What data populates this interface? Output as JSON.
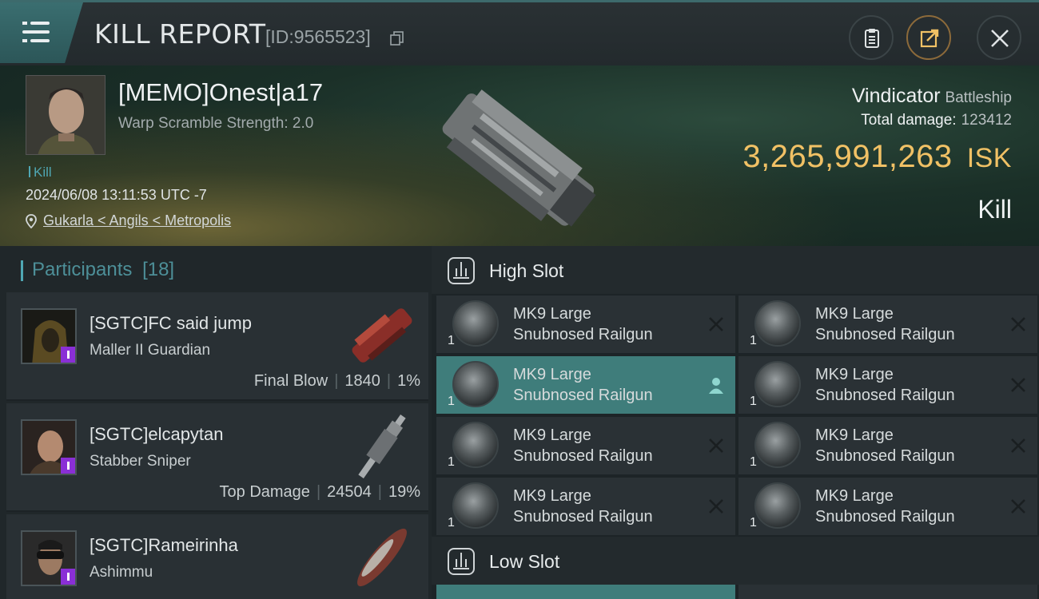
{
  "header": {
    "title": "KILL REPORT",
    "report_id": "[ID:9565523]",
    "icons": [
      "menu-icon",
      "copy-icon",
      "clipboard-icon",
      "share-icon",
      "close-icon"
    ]
  },
  "victim": {
    "name": "[MEMO]Onest|a17",
    "warp_scramble": "Warp Scramble Strength: 2.0",
    "tag": "Kill",
    "timestamp": "2024/06/08 13:11:53 UTC -7",
    "location": "Gukarla < Angils < Metropolis",
    "ship_name": "Vindicator",
    "ship_class": "Battleship",
    "total_damage_label": "Total damage:",
    "total_damage": "123412",
    "isk_value": "3,265,991,263",
    "isk_unit": "ISK",
    "result": "Kill"
  },
  "participants": {
    "label": "Participants",
    "count": "[18]",
    "rows": [
      {
        "name": "[SGTC]FC said jump",
        "ship": "Maller II Guardian",
        "role": "Final Blow",
        "damage": "1840",
        "percent": "1%"
      },
      {
        "name": "[SGTC]elcapytan",
        "ship": "Stabber Sniper",
        "role": "Top Damage",
        "damage": "24504",
        "percent": "19%"
      },
      {
        "name": "[SGTC]Rameirinha",
        "ship": "Ashimmu",
        "role": "",
        "damage": "",
        "percent": ""
      }
    ]
  },
  "fitting": {
    "high_slot_label": "High Slot",
    "low_slot_label": "Low Slot",
    "module_line1": "MK9 Large",
    "module_line2": "Snubnosed Railgun",
    "module_qty": "1",
    "active_index": 2
  },
  "colors": {
    "accent_teal": "#4fa7b4",
    "isk_gold": "#f1c165",
    "active_module": "#3f7d7b",
    "badge_purple": "#8a2fd6"
  }
}
